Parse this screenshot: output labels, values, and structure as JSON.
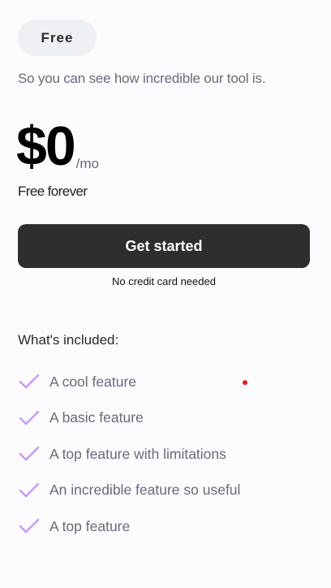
{
  "plan": {
    "name": "Free",
    "description": "So you can see how incredible our tool is.",
    "price": "$0",
    "period": "/mo",
    "billing_note": "Free forever",
    "cta_label": "Get started",
    "cta_note": "No credit card needed"
  },
  "features": {
    "heading": "What's included:",
    "icon": "check-icon",
    "check_color": "#c49cf0",
    "items": [
      "A cool feature",
      "A basic feature",
      "A top feature with limitations",
      "An incredible feature so useful",
      "A top feature"
    ]
  }
}
